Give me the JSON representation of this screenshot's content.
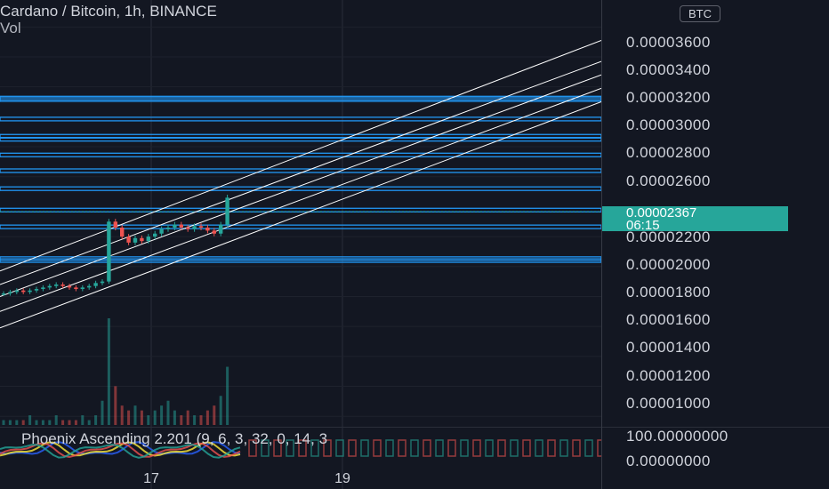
{
  "header": {
    "symbol_line": "Cardano / Bitcoin, 1h, BINANCE",
    "volume_label": "Vol"
  },
  "price_axis": {
    "ticks": [
      "0.00003600",
      "0.00003400",
      "0.00003200",
      "0.00003000",
      "0.00002800",
      "0.00002600",
      "0.00002200",
      "0.00002000",
      "0.00001800",
      "0.00001600",
      "0.00001400",
      "0.00001200",
      "0.00001000"
    ],
    "currency_badge": "BTC",
    "current_price": "0.00002367",
    "countdown": "06:15"
  },
  "indicator": {
    "title": "Phoenix Ascending 2.201 (9, 6, 3, 32, 0, 14, 3",
    "ticks": [
      "100.00000000",
      "0.00000000"
    ]
  },
  "time_axis": {
    "labels": [
      "17",
      "19"
    ]
  },
  "colors": {
    "up": "#26a69a",
    "down": "#ef5350",
    "levels": "#2196f3",
    "channel": "#ffffff",
    "current_price": "#26a69a"
  },
  "chart_data": {
    "type": "candlestick",
    "title": "Cardano / Bitcoin, 1h, BINANCE",
    "ylim": [
      9.3e-06,
      3.78e-05
    ],
    "yticks": [
      3.6e-05,
      3.4e-05,
      3.2e-05,
      3e-05,
      2.8e-05,
      2.6e-05,
      2.2e-05,
      2e-05,
      1.8e-05,
      1.6e-05,
      1.4e-05,
      1.2e-05,
      1e-05
    ],
    "x_ticks": [
      "17",
      "19"
    ],
    "current_price": 2.367e-05,
    "horizontal_levels": [
      3.125e-05,
      3.115e-05,
      2.985e-05,
      2.87e-05,
      2.85e-05,
      2.745e-05,
      2.64e-05,
      2.52e-05,
      2.377e-05,
      2.265e-05,
      2.053e-05,
      2.04e-05
    ],
    "channel_lines": [
      {
        "start": 1.97e-05,
        "end": 3.51e-05
      },
      {
        "start": 1.88e-05,
        "end": 3.37e-05
      },
      {
        "start": 1.8e-05,
        "end": 3.28e-05
      },
      {
        "start": 1.7e-05,
        "end": 3.19e-05
      },
      {
        "start": 1.59e-05,
        "end": 3.1e-05
      }
    ],
    "price_series": [
      1.82e-05,
      1.83e-05,
      1.84e-05,
      1.83e-05,
      1.84e-05,
      1.85e-05,
      1.86e-05,
      1.87e-05,
      1.88e-05,
      1.87e-05,
      1.86e-05,
      1.85e-05,
      1.86e-05,
      1.87e-05,
      1.89e-05,
      1.9e-05,
      2.3e-05,
      2.26e-05,
      2.2e-05,
      2.16e-05,
      2.19e-05,
      2.17e-05,
      2.2e-05,
      2.22e-05,
      2.25e-05,
      2.26e-05,
      2.28e-05,
      2.26e-05,
      2.25e-05,
      2.27e-05,
      2.26e-05,
      2.24e-05,
      2.22e-05,
      2.28e-05,
      2.46e-05
    ],
    "volume_series": [
      1,
      1,
      1,
      1,
      2,
      1,
      1,
      1,
      2,
      1,
      1,
      1,
      2,
      1,
      2,
      5,
      22,
      8,
      4,
      3,
      4,
      3,
      2,
      3,
      4,
      5,
      3,
      2,
      3,
      2,
      2,
      3,
      4,
      6,
      12
    ]
  }
}
